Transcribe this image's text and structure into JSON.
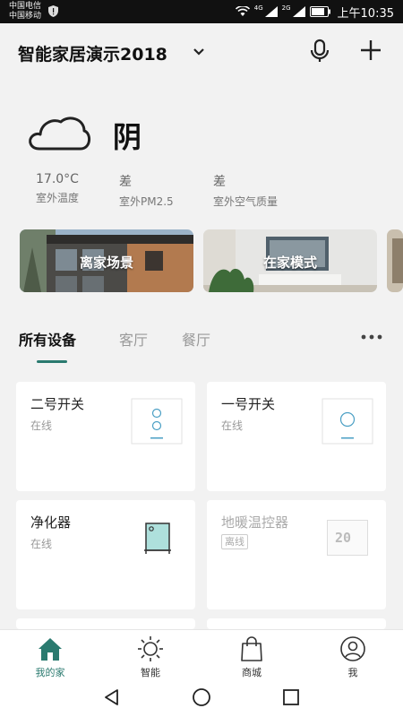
{
  "status_bar": {
    "carrier_1": "中国电信",
    "carrier_2": "中国移动",
    "net_1": "4G",
    "net_2": "2G",
    "time": "上午10:35"
  },
  "header": {
    "home_name": "智能家居演示2018"
  },
  "weather": {
    "condition": "阴",
    "icon": "cloud-icon",
    "stats": [
      {
        "value": "17.0°C",
        "label": "室外温度"
      },
      {
        "value": "差",
        "label": "室外PM2.5"
      },
      {
        "value": "差",
        "label": "室外空气质量"
      }
    ]
  },
  "scenes": [
    {
      "label": "离家场景"
    },
    {
      "label": "在家模式"
    }
  ],
  "tabs": [
    {
      "label": "所有设备",
      "active": true
    },
    {
      "label": "客厅",
      "active": false
    },
    {
      "label": "餐厅",
      "active": false
    }
  ],
  "devices": [
    {
      "name": "二号开关",
      "status": "在线",
      "icon": "double-switch-icon"
    },
    {
      "name": "一号开关",
      "status": "在线",
      "icon": "single-switch-icon"
    },
    {
      "name": "净化器",
      "status": "在线",
      "icon": "purifier-icon"
    },
    {
      "name": "地暖温控器",
      "status": "离线",
      "icon": "thermostat-icon",
      "thermostat_display": "20"
    }
  ],
  "bottom_nav": [
    {
      "label": "我的家",
      "icon": "home-icon",
      "active": true
    },
    {
      "label": "智能",
      "icon": "sun-icon",
      "active": false
    },
    {
      "label": "商城",
      "icon": "bag-icon",
      "active": false
    },
    {
      "label": "我",
      "icon": "user-icon",
      "active": false
    }
  ],
  "colors": {
    "accent": "#2a7a6f",
    "background": "#f2f2f2"
  }
}
